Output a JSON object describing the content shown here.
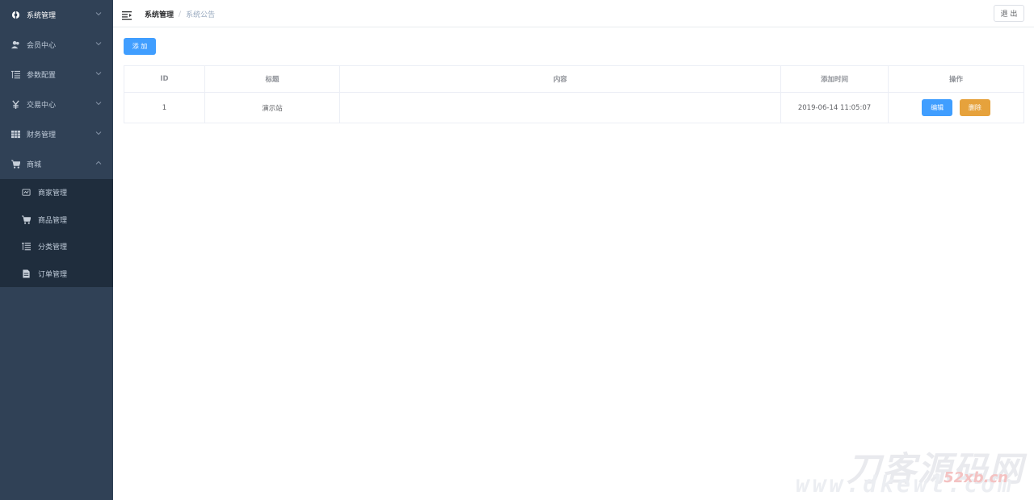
{
  "sidebar": {
    "items": [
      {
        "label": "系统管理",
        "icon": "gear-icon"
      },
      {
        "label": "会员中心",
        "icon": "users-icon"
      },
      {
        "label": "参数配置",
        "icon": "list-icon"
      },
      {
        "label": "交易中心",
        "icon": "yen-icon"
      },
      {
        "label": "财务管理",
        "icon": "grid-icon"
      },
      {
        "label": "商城",
        "icon": "cart-icon"
      }
    ],
    "submenu": [
      {
        "label": "商家管理",
        "icon": "store-icon"
      },
      {
        "label": "商品管理",
        "icon": "cart-icon"
      },
      {
        "label": "分类管理",
        "icon": "list-icon"
      },
      {
        "label": "订单管理",
        "icon": "document-icon"
      }
    ]
  },
  "header": {
    "breadcrumb": [
      "系统管理",
      "系统公告"
    ],
    "logout_label": "退 出"
  },
  "toolbar": {
    "add_label": "添 加"
  },
  "table": {
    "columns": [
      "ID",
      "标题",
      "内容",
      "添加时间",
      "操作"
    ],
    "rows": [
      {
        "id": "1",
        "title": "演示站",
        "content": "",
        "time": "2019-06-14 11:05:07"
      }
    ],
    "edit_label": "编辑",
    "delete_label": "删除"
  },
  "watermark": {
    "main": "刀客源码网",
    "sub": "www.dkewl.com",
    "red": "52xb.cn"
  },
  "colors": {
    "sidebar_bg": "#304156",
    "submenu_bg": "#1f2d3d",
    "primary": "#409eff",
    "warning": "#e6a23c"
  }
}
